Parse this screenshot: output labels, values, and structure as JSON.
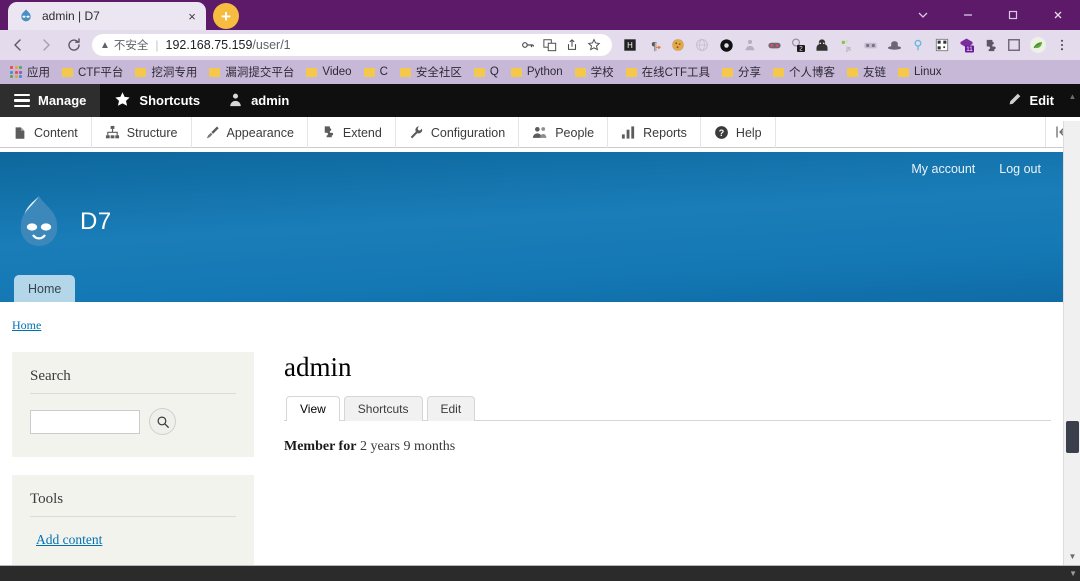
{
  "browser": {
    "tab": {
      "title": "admin | D7",
      "favicon": "drupal-droplet-icon",
      "close": "×"
    },
    "new_tab_label": "+",
    "window_controls": [
      "chevron-down",
      "minimize",
      "maximize",
      "close"
    ],
    "nav": {
      "back": "←",
      "forward": "→",
      "reload": "↻"
    },
    "omnibox": {
      "security_warning": "不安全",
      "warning_icon": "⚠",
      "url_host": "192.168.75.159",
      "url_path": "/user/1",
      "icons": [
        "key-icon",
        "translate-icon",
        "share-icon",
        "bookmark-star-icon"
      ]
    },
    "extensions": [
      "hackbar-icon",
      "pilcrow-icon",
      "cookie-icon",
      "globe-icon",
      "circle-icon",
      "person-icon",
      "mask-icon",
      "chat-badge-icon",
      "spy-icon",
      "js-icon",
      "glasses-icon",
      "hat-icon",
      "pin-icon",
      "qr-icon",
      "purple-badge-icon",
      "puzzle-icon",
      "square-icon",
      "leaf-icon",
      "kebab-menu-icon"
    ],
    "extension_badges": {
      "chat": "2",
      "purple": "11"
    },
    "bookmarks": [
      {
        "label": "应用",
        "icon": "apps-grid-icon"
      },
      {
        "label": "CTF平台",
        "icon": "folder-icon"
      },
      {
        "label": "挖洞专用",
        "icon": "folder-icon"
      },
      {
        "label": "漏洞提交平台",
        "icon": "folder-icon"
      },
      {
        "label": "Video",
        "icon": "folder-icon"
      },
      {
        "label": "C",
        "icon": "folder-icon"
      },
      {
        "label": "安全社区",
        "icon": "folder-icon"
      },
      {
        "label": "Q",
        "icon": "folder-icon"
      },
      {
        "label": "Python",
        "icon": "folder-icon"
      },
      {
        "label": "学校",
        "icon": "folder-icon"
      },
      {
        "label": "在线CTF工具",
        "icon": "folder-icon"
      },
      {
        "label": "分享",
        "icon": "folder-icon"
      },
      {
        "label": "个人博客",
        "icon": "folder-icon"
      },
      {
        "label": "友链",
        "icon": "folder-icon"
      },
      {
        "label": "Linux",
        "icon": "folder-icon"
      }
    ]
  },
  "drupal_toolbar": {
    "items": [
      {
        "label": "Manage",
        "icon": "hamburger-icon",
        "active": true
      },
      {
        "label": "Shortcuts",
        "icon": "star-icon",
        "active": false
      },
      {
        "label": "admin",
        "icon": "user-icon",
        "active": false
      }
    ],
    "edit": {
      "label": "Edit",
      "icon": "pencil-icon"
    }
  },
  "admin_menu": {
    "items": [
      {
        "label": "Content",
        "icon": "document-icon"
      },
      {
        "label": "Structure",
        "icon": "sitemap-icon"
      },
      {
        "label": "Appearance",
        "icon": "brush-icon"
      },
      {
        "label": "Extend",
        "icon": "puzzle-icon"
      },
      {
        "label": "Configuration",
        "icon": "wrench-icon"
      },
      {
        "label": "People",
        "icon": "people-icon"
      },
      {
        "label": "Reports",
        "icon": "bars-icon"
      },
      {
        "label": "Help",
        "icon": "question-icon"
      }
    ],
    "collapse_icon": "collapse-left-icon"
  },
  "site": {
    "name": "D7",
    "logo": "drupal-droplet-icon",
    "account_links": [
      {
        "label": "My account"
      },
      {
        "label": "Log out"
      }
    ],
    "primary_menu": [
      {
        "label": "Home",
        "active": true
      }
    ],
    "breadcrumb": [
      {
        "label": "Home"
      }
    ]
  },
  "sidebar": {
    "blocks": [
      {
        "title": "Search",
        "type": "search",
        "input_value": "",
        "input_placeholder": "",
        "button_icon": "magnifier-icon"
      },
      {
        "title": "Tools",
        "type": "links",
        "links": [
          {
            "label": "Add content"
          }
        ]
      }
    ]
  },
  "main": {
    "title": "admin",
    "tabs": [
      {
        "label": "View",
        "active": true
      },
      {
        "label": "Shortcuts",
        "active": false
      },
      {
        "label": "Edit",
        "active": false
      }
    ],
    "member": {
      "label": "Member for",
      "value": "2 years 9 months"
    }
  },
  "colors": {
    "browser_chrome": "#5c1a69",
    "bookmarks_bar": "#c7b8d8",
    "toolbar_dark": "#0f0f0f",
    "hero_blue": "#1478b4",
    "link_blue": "#0071b3",
    "block_bg": "#f3f3ee",
    "newtab_yellow": "#f6bc3f"
  }
}
